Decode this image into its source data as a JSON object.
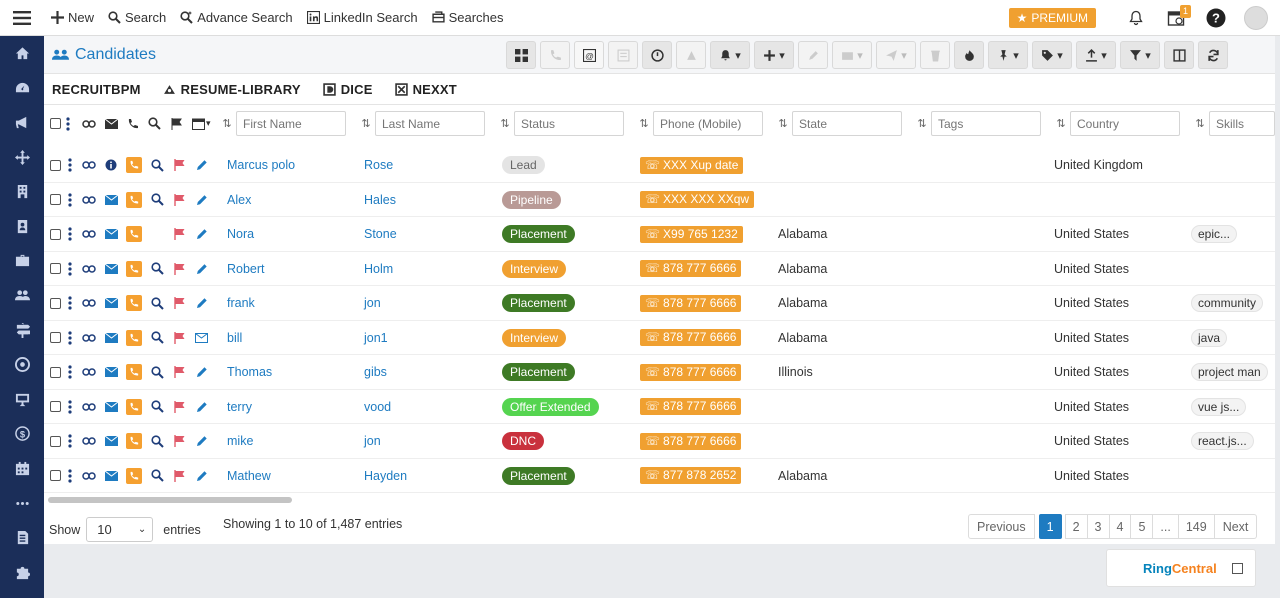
{
  "topnav": [
    {
      "label": "New",
      "icon": "plus-icon"
    },
    {
      "label": "Search",
      "icon": "search-icon"
    },
    {
      "label": "Advance Search",
      "icon": "advance-search-icon"
    },
    {
      "label": "LinkedIn Search",
      "icon": "linkedin-icon"
    },
    {
      "label": "Searches",
      "icon": "searches-icon"
    }
  ],
  "premium_label": "PREMIUM",
  "calendar_badge": "1",
  "page_title": "Candidates",
  "tabs": [
    {
      "label": "RECRUITBPM"
    },
    {
      "label": "RESUME-LIBRARY"
    },
    {
      "label": "DICE"
    },
    {
      "label": "NEXXT"
    }
  ],
  "filters": {
    "first_name": "First Name",
    "last_name": "Last Name",
    "status": "Status",
    "phone": "Phone (Mobile)",
    "state": "State",
    "tags": "Tags",
    "country": "Country",
    "skills": "Skills"
  },
  "status_colors": {
    "Lead": "#e4e4e4",
    "Pipeline": "#b99a96",
    "Placement": "#3e7a25",
    "Interview": "#f0a030",
    "Offer Extended": "#55d450",
    "DNC": "#c9313d"
  },
  "rows": [
    {
      "first": "Marcus polo",
      "last": "Rose",
      "status": "Lead",
      "phone": "XXX Xup date",
      "state": "",
      "country": "United Kingdom",
      "skill": "",
      "info": true,
      "email_outline": false,
      "search": true
    },
    {
      "first": "Alex",
      "last": "Hales",
      "status": "Pipeline",
      "phone": "XXX XXX XXqw",
      "state": "",
      "country": "",
      "skill": "",
      "info": false,
      "email_outline": false,
      "search": true
    },
    {
      "first": "Nora",
      "last": "Stone",
      "status": "Placement",
      "phone": "X99 765 1232",
      "state": "Alabama",
      "country": "United States",
      "skill": "epic...",
      "info": false,
      "email_outline": false,
      "search": false
    },
    {
      "first": "Robert",
      "last": "Holm",
      "status": "Interview",
      "phone": "878 777 6666",
      "state": "Alabama",
      "country": "United States",
      "skill": "",
      "info": false,
      "email_outline": false,
      "search": true
    },
    {
      "first": "frank",
      "last": "jon",
      "status": "Placement",
      "phone": "878 777 6666",
      "state": "Alabama",
      "country": "United States",
      "skill": "community",
      "info": false,
      "email_outline": false,
      "search": true
    },
    {
      "first": "bill",
      "last": "jon1",
      "status": "Interview",
      "phone": "878 777 6666",
      "state": "Alabama",
      "country": "United States",
      "skill": "java",
      "info": false,
      "email_outline": true,
      "search": true
    },
    {
      "first": "Thomas",
      "last": "gibs",
      "status": "Placement",
      "phone": "878 777 6666",
      "state": "Illinois",
      "country": "United States",
      "skill": "project man",
      "info": false,
      "email_outline": false,
      "search": true
    },
    {
      "first": "terry",
      "last": "vood",
      "status": "Offer Extended",
      "phone": "878 777 6666",
      "state": "",
      "country": "United States",
      "skill": "vue js...",
      "info": false,
      "email_outline": false,
      "search": true
    },
    {
      "first": "mike",
      "last": "jon",
      "status": "DNC",
      "phone": "878 777 6666",
      "state": "",
      "country": "United States",
      "skill": "react.js...",
      "info": false,
      "email_outline": false,
      "search": true
    },
    {
      "first": "Mathew",
      "last": "Hayden",
      "status": "Placement",
      "phone": "877 878 2652",
      "state": "Alabama",
      "country": "United States",
      "skill": "",
      "info": false,
      "email_outline": false,
      "search": true
    }
  ],
  "footer": {
    "show_label": "Show",
    "entries_value": "10",
    "entries_label": "entries",
    "showing": "Showing 1 to 10 of 1,487 entries",
    "pages": [
      "Previous",
      "1",
      "2",
      "3",
      "4",
      "5",
      "...",
      "149",
      "Next"
    ],
    "active_page": "1"
  },
  "ringcentral": {
    "part1": "Ring",
    "part2": "Central"
  }
}
